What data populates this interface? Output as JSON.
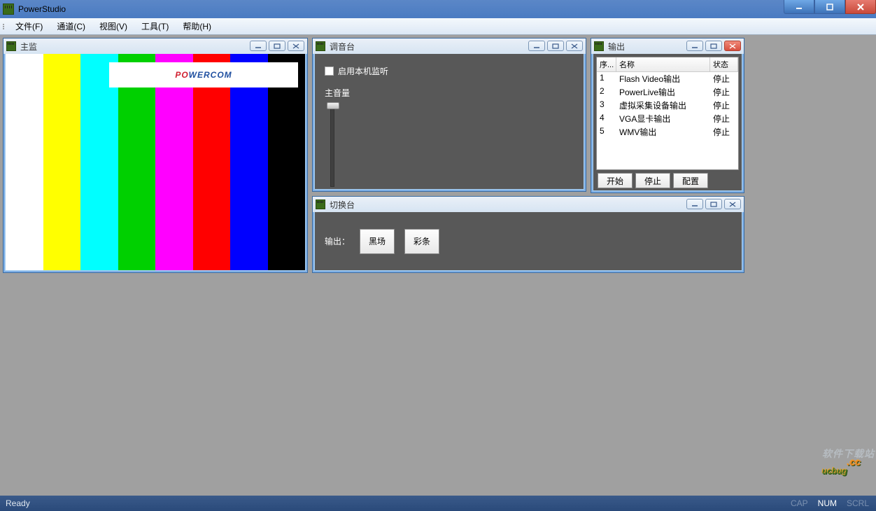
{
  "app": {
    "title": "PowerStudio"
  },
  "menu": {
    "file": "文件(F)",
    "channel": "通道(C)",
    "view": "视图(V)",
    "tools": "工具(T)",
    "help": "帮助(H)"
  },
  "monitor": {
    "title": "主监",
    "logo_red": "PO",
    "logo_blue": "WERCOM",
    "bar_colors": [
      "#ffffff",
      "#ffff00",
      "#00ffff",
      "#00d000",
      "#ff00ff",
      "#ff0000",
      "#0000ff",
      "#000000"
    ]
  },
  "mixer": {
    "title": "调音台",
    "local_listen": "启用本机监听",
    "master_volume": "主音量"
  },
  "output": {
    "title": "输出",
    "col_seq": "序...",
    "col_name": "名称",
    "col_status": "状态",
    "rows": [
      {
        "seq": "1",
        "name": "Flash Video输出",
        "status": "停止"
      },
      {
        "seq": "2",
        "name": "PowerLive输出",
        "status": "停止"
      },
      {
        "seq": "3",
        "name": "虚拟采集设备输出",
        "status": "停止"
      },
      {
        "seq": "4",
        "name": "VGA显卡输出",
        "status": "停止"
      },
      {
        "seq": "5",
        "name": "WMV输出",
        "status": "停止"
      }
    ],
    "btn_start": "开始",
    "btn_stop": "停止",
    "btn_config": "配置"
  },
  "switcher": {
    "title": "切换台",
    "output_label": "输出：",
    "btn_black": "黑场",
    "btn_bars": "彩条"
  },
  "status": {
    "ready": "Ready",
    "cap": "CAP",
    "num": "NUM",
    "scrl": "SCRL"
  },
  "watermark": {
    "small": "软件下载站",
    "main": "ucbug",
    "cc": ".cc"
  }
}
